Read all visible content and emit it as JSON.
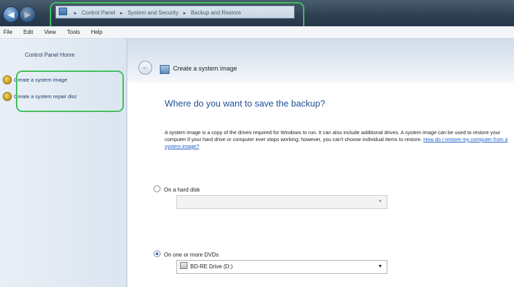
{
  "address_bar": {
    "crumbs": [
      "Control Panel",
      "System and Security",
      "Backup and Restore"
    ],
    "separator": "▸"
  },
  "menu": [
    "File",
    "Edit",
    "View",
    "Tools",
    "Help"
  ],
  "sidebar": {
    "home": "Control Panel Home",
    "links": [
      "Create a system image",
      "Create a system repair disc"
    ]
  },
  "wizard": {
    "title": "Create a system image",
    "heading": "Where do you want to save the backup?",
    "description": "A system image is a copy of the drives required for Windows to run. It can also include additional drives. A system image can be used to restore your computer if your hard drive or computer ever stops working; however, you can't choose individual items to restore.",
    "help_link": "How do I restore my computer from a system image?",
    "options": [
      {
        "label": "On a hard disk",
        "selected": false,
        "select_value": ""
      },
      {
        "label": "On one or more DVDs",
        "selected": true,
        "select_value": "BD-RE Drive (D:)"
      }
    ]
  },
  "colors": {
    "highlight": "#3fbf5a",
    "heading": "#1f4e97",
    "link": "#1f5fc8"
  }
}
